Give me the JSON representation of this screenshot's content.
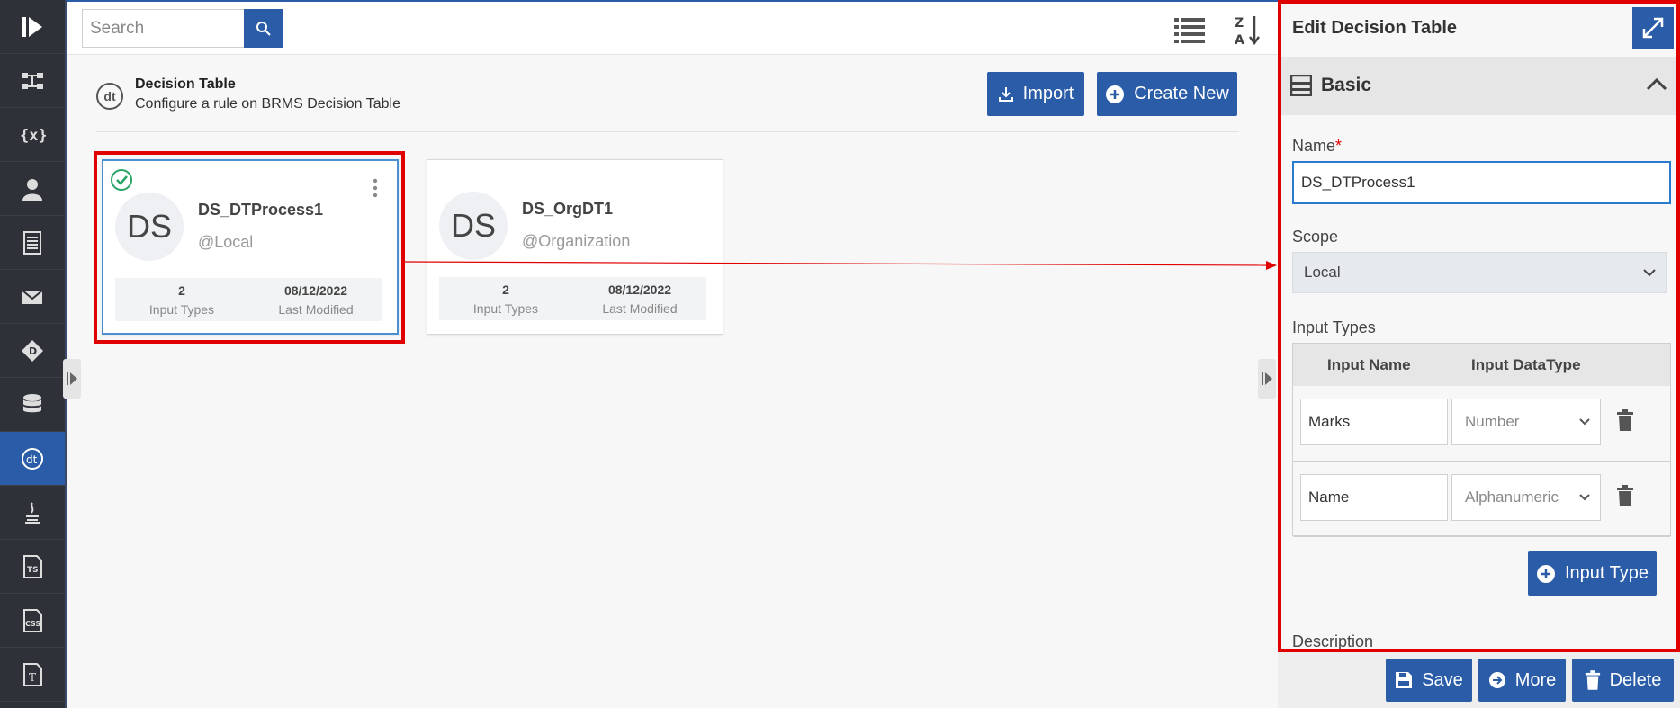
{
  "search": {
    "placeholder": "Search"
  },
  "header": {
    "title": "Decision Table",
    "subtitle": "Configure a rule on BRMS Decision Table",
    "icon_text": "dt"
  },
  "toolbar": {
    "import_label": "Import",
    "create_new_label": "Create New"
  },
  "cards": [
    {
      "initials": "DS",
      "name": "DS_DTProcess1",
      "scope": "@Local",
      "input_types_count": "2",
      "input_types_label": "Input Types",
      "last_modified": "08/12/2022",
      "last_modified_label": "Last Modified",
      "selected": true
    },
    {
      "initials": "DS",
      "name": "DS_OrgDT1",
      "scope": "@Organization",
      "input_types_count": "2",
      "input_types_label": "Input Types",
      "last_modified": "08/12/2022",
      "last_modified_label": "Last Modified",
      "selected": false
    }
  ],
  "edit_panel": {
    "title": "Edit Decision Table",
    "section_label": "Basic",
    "name_label": "Name",
    "name_required_marker": "*",
    "name_value": "DS_DTProcess1",
    "scope_label": "Scope",
    "scope_value": "Local",
    "input_types_label": "Input Types",
    "input_table": {
      "headers": [
        "Input Name",
        "Input DataType"
      ],
      "rows": [
        {
          "name": "Marks",
          "datatype": "Number"
        },
        {
          "name": "Name",
          "datatype": "Alphanumeric"
        }
      ]
    },
    "add_input_type_label": "Input Type",
    "description_label": "Description",
    "footer": {
      "save_label": "Save",
      "more_label": "More",
      "delete_label": "Delete"
    }
  },
  "colors": {
    "accent": "#2a5ca8",
    "highlight": "#e00000",
    "rail_bg": "#2e3138",
    "success": "#27a567"
  },
  "rail": {
    "items": [
      "logo-icon",
      "flow-icon",
      "variables-icon",
      "user-icon",
      "document-icon",
      "mail-icon",
      "diamond-icon",
      "database-icon",
      "decision-table-icon",
      "java-icon",
      "typescript-icon",
      "css-icon",
      "text-icon"
    ],
    "active_index": 8
  }
}
